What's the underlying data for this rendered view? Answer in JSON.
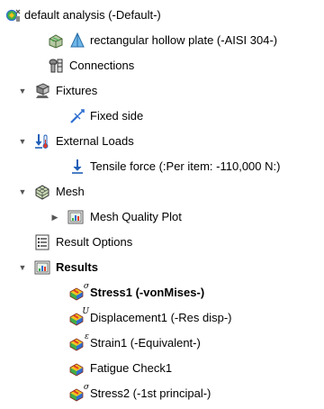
{
  "tree": {
    "root": {
      "label": "default analysis (-Default-)",
      "icon": "study-icon"
    },
    "part": {
      "label": "rectangular hollow plate (-AISI 304-)",
      "icon": "part-icon"
    },
    "connections": {
      "label": "Connections",
      "icon": "connections-icon"
    },
    "fixtures": {
      "label": "Fixtures",
      "icon": "fixtures-icon",
      "expanded": true
    },
    "fixed_side": {
      "label": "Fixed side",
      "icon": "fixed-geometry-icon"
    },
    "external_loads": {
      "label": "External Loads",
      "icon": "external-loads-icon",
      "expanded": true
    },
    "tensile_force": {
      "label": "Tensile force (:Per item: -110,000 N:)",
      "icon": "force-arrow-icon"
    },
    "mesh": {
      "label": "Mesh",
      "icon": "mesh-icon",
      "expanded": true
    },
    "mesh_quality_plot": {
      "label": "Mesh Quality Plot",
      "icon": "plot-folder-icon",
      "expanded": false
    },
    "result_options": {
      "label": "Result Options",
      "icon": "result-options-icon"
    },
    "results": {
      "label": "Results",
      "icon": "results-folder-icon",
      "expanded": true
    },
    "result_items": [
      {
        "label": "Stress1 (-vonMises-)",
        "superscript": "σ",
        "active": true,
        "icon": "stress-plot-icon"
      },
      {
        "label": "Displacement1 (-Res disp-)",
        "superscript": "U",
        "active": false,
        "icon": "displacement-plot-icon"
      },
      {
        "label": "Strain1 (-Equivalent-)",
        "superscript": "ε",
        "active": false,
        "icon": "strain-plot-icon"
      },
      {
        "label": "Fatigue Check1",
        "superscript": "",
        "active": false,
        "icon": "fatigue-plot-icon"
      },
      {
        "label": "Stress2 (-1st principal-)",
        "superscript": "σ",
        "active": false,
        "icon": "stress-plot-icon"
      }
    ]
  },
  "colors": {
    "plot_red": "#e23b2a",
    "plot_green": "#3fae49",
    "plot_blue": "#2f6fd1",
    "plot_yellow": "#f2c21b",
    "arrow_blue": "#1f5fb8"
  }
}
